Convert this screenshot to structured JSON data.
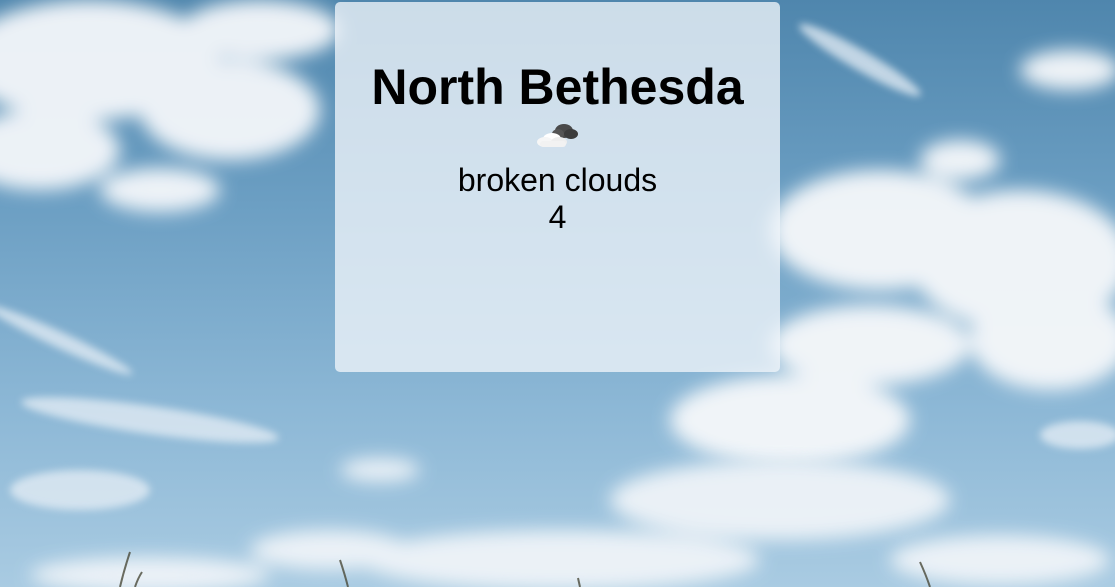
{
  "weather": {
    "city": "North Bethesda",
    "icon": "broken-clouds-icon",
    "description": "broken clouds",
    "temperature": "4"
  },
  "colors": {
    "sky": "#6c9fc3",
    "card": "#eef3f8",
    "text": "#000000"
  }
}
